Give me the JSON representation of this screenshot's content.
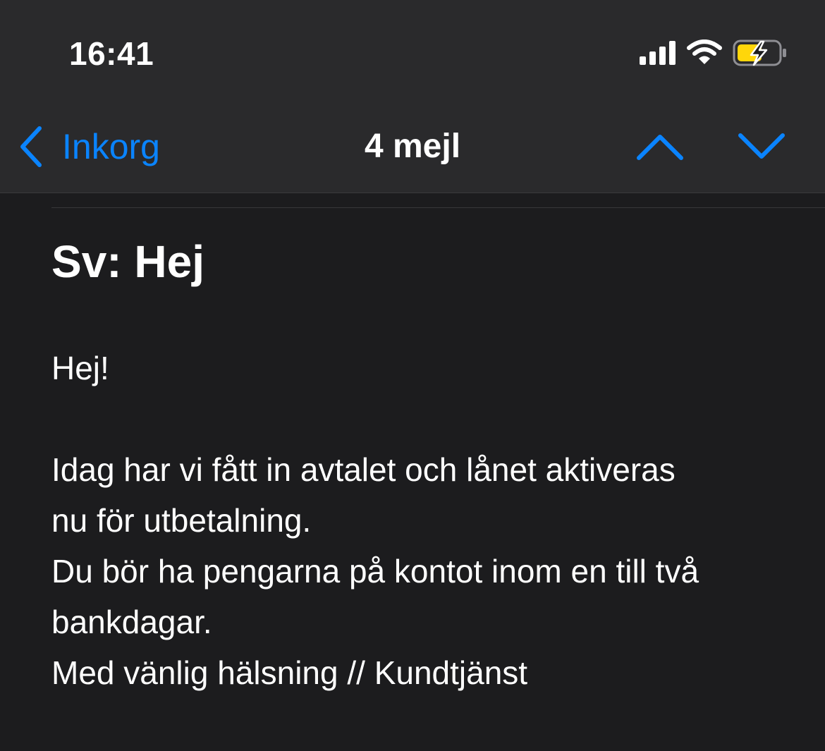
{
  "status_bar": {
    "time": "16:41",
    "icons": [
      "cellular-signal-icon",
      "wifi-icon",
      "battery-charging-icon"
    ]
  },
  "nav": {
    "back_label": "Inkorg",
    "title": "4 mejl",
    "up_icon": "chevron-up-icon",
    "down_icon": "chevron-down-icon"
  },
  "email": {
    "subject": "Sv: Hej",
    "greeting": "Hej!",
    "lines": [
      "Idag har vi fått in avtalet och lånet aktiveras",
      "nu för utbetalning.",
      "Du bör ha pengarna på kontot inom en till två",
      "bankdagar.",
      "Med vänlig hälsning // Kundtjänst"
    ]
  },
  "colors": {
    "accent": "#0a84ff",
    "background": "#1c1c1e",
    "header": "#2a2a2c",
    "battery": "#ffd60a"
  }
}
